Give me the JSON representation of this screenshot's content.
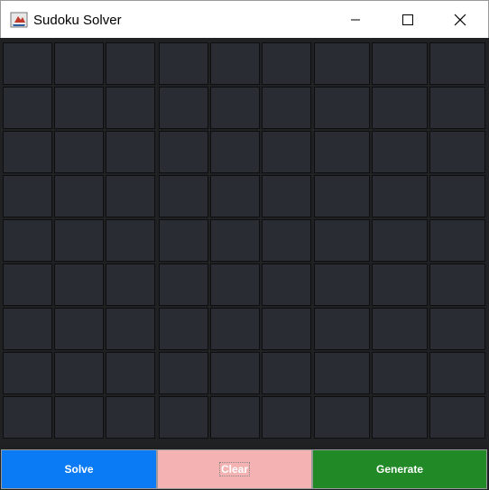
{
  "window": {
    "title": "Sudoku Solver",
    "icon": "java-cup-icon"
  },
  "board": {
    "rows": 9,
    "cols": 9,
    "cells": [
      [
        "",
        "",
        "",
        "",
        "",
        "",
        "",
        "",
        ""
      ],
      [
        "",
        "",
        "",
        "",
        "",
        "",
        "",
        "",
        ""
      ],
      [
        "",
        "",
        "",
        "",
        "",
        "",
        "",
        "",
        ""
      ],
      [
        "",
        "",
        "",
        "",
        "",
        "",
        "",
        "",
        ""
      ],
      [
        "",
        "",
        "",
        "",
        "",
        "",
        "",
        "",
        ""
      ],
      [
        "",
        "",
        "",
        "",
        "",
        "",
        "",
        "",
        ""
      ],
      [
        "",
        "",
        "",
        "",
        "",
        "",
        "",
        "",
        ""
      ],
      [
        "",
        "",
        "",
        "",
        "",
        "",
        "",
        "",
        ""
      ],
      [
        "",
        "",
        "",
        "",
        "",
        "",
        "",
        "",
        ""
      ]
    ]
  },
  "buttons": {
    "solve_label": "Solve",
    "clear_label": "Clear",
    "generate_label": "Generate"
  },
  "colors": {
    "solve": "#0a7bf5",
    "clear": "#f4b3b2",
    "generate": "#218a26",
    "cell": "#292c32"
  }
}
